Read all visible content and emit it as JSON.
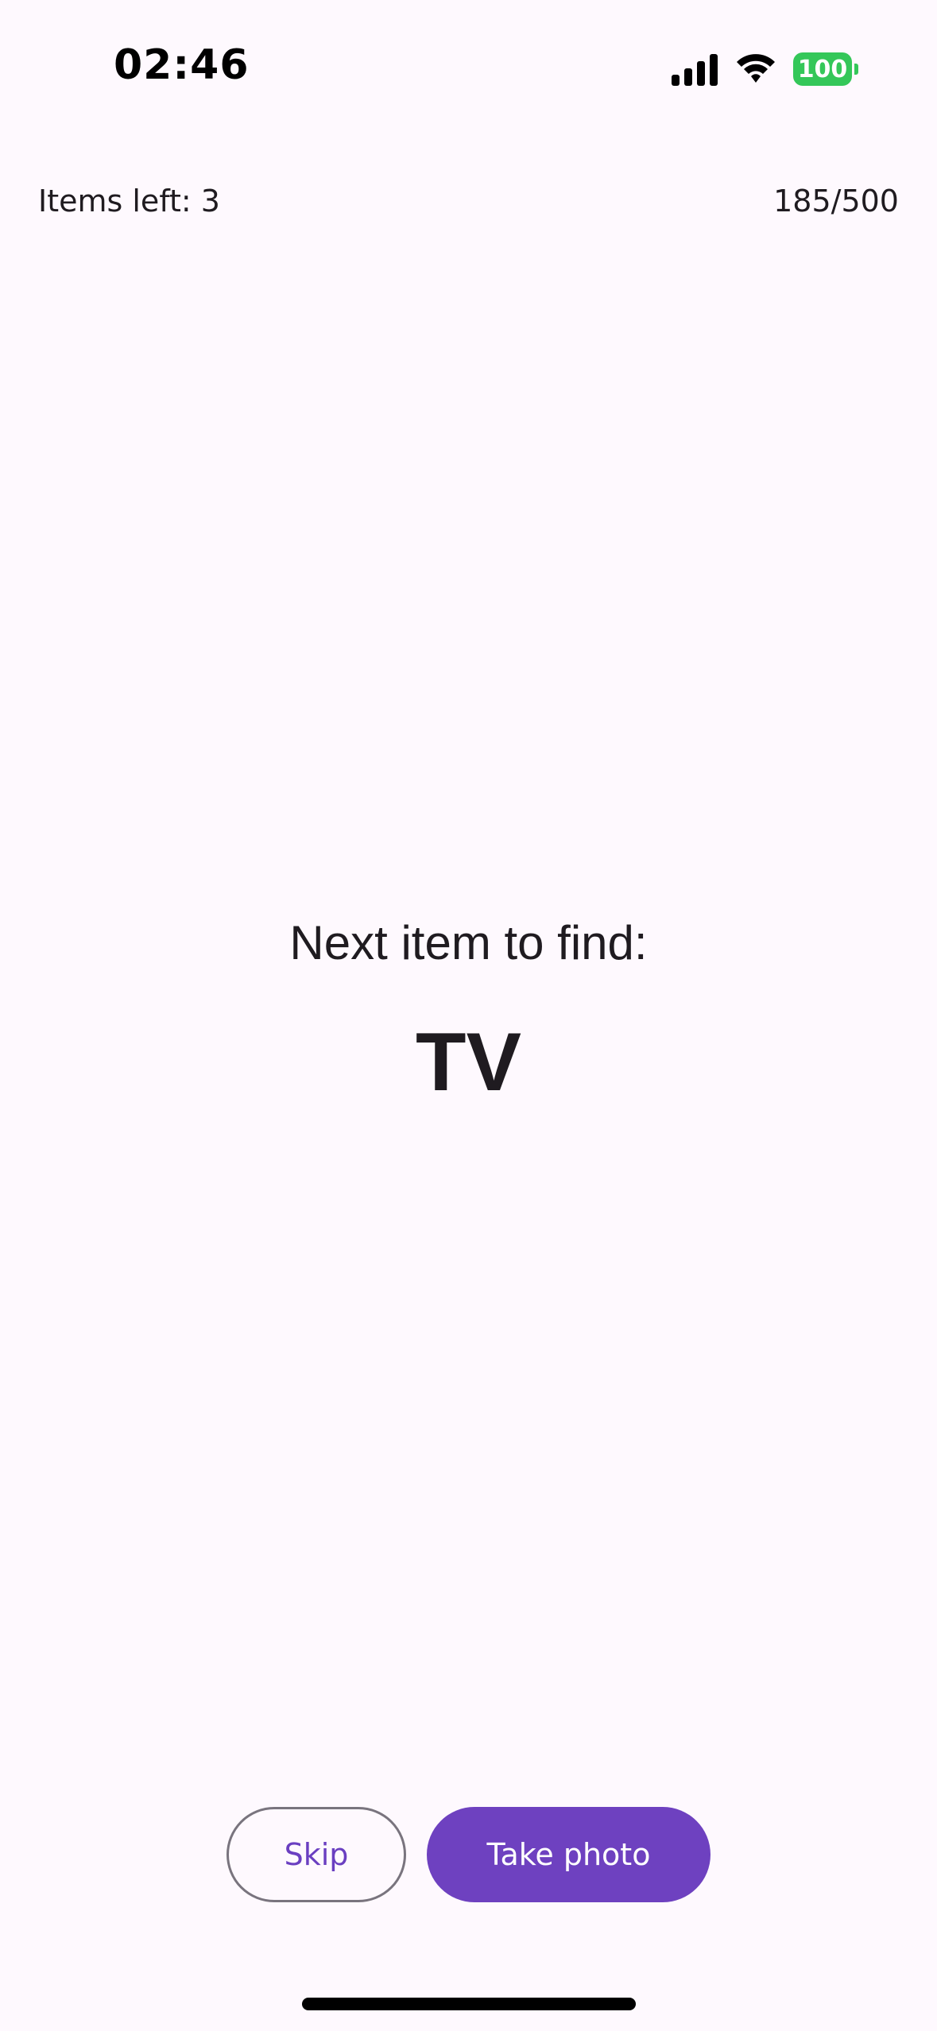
{
  "status_bar": {
    "time": "02:46",
    "battery": "100",
    "icons": [
      "signal-icon",
      "wifi-icon",
      "battery-icon"
    ],
    "battery_color": "#34c759"
  },
  "header": {
    "items_left": "Items left: 3",
    "progress": "185/500"
  },
  "main": {
    "prompt": "Next item to find:",
    "item": "TV"
  },
  "actions": {
    "skip_label": "Skip",
    "photo_label": "Take photo",
    "accent_color": "#6e41c0"
  }
}
